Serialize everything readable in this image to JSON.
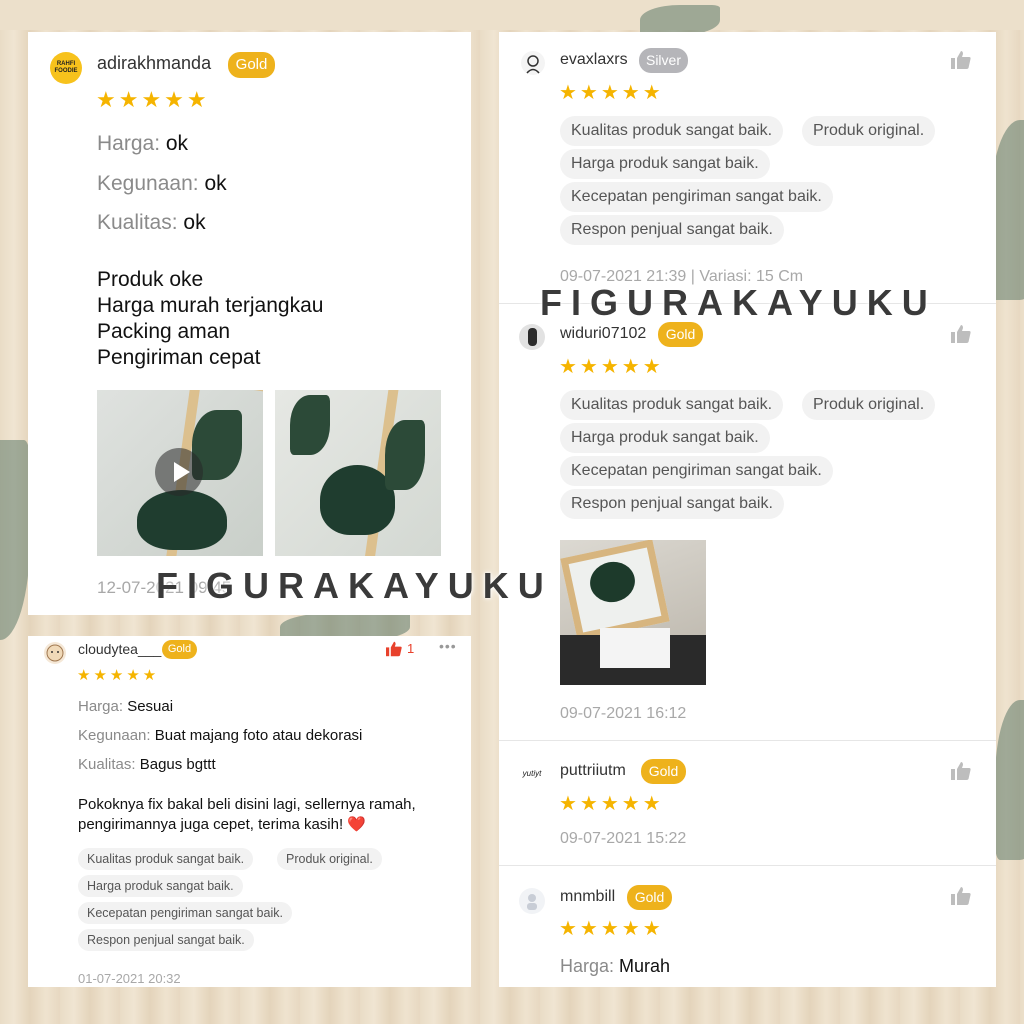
{
  "watermark": "FIGURAKAYUKU",
  "review1": {
    "username": "adirakhmanda",
    "badge": "Gold",
    "avatar_text": "RAHFI FOODIE",
    "stars": "★★★★★",
    "harga_label": "Harga:",
    "harga_value": "ok",
    "kegunaan_label": "Kegunaan:",
    "kegunaan_value": "ok",
    "kualitas_label": "Kualitas:",
    "kualitas_value": "ok",
    "body_lines": [
      "Produk oke",
      "Harga murah terjangkau",
      "Packing aman",
      "Pengiriman cepat"
    ],
    "timestamp": "12-07-2021 09:45",
    "media": [
      "video-thumbnail",
      "photo"
    ]
  },
  "review2": {
    "username": "evaxlaxrs",
    "badge": "Silver",
    "stars": "★★★★★",
    "tags": [
      "Kualitas produk sangat baik.",
      "Produk original.",
      "Harga produk sangat baik.",
      "Kecepatan pengiriman sangat baik.",
      "Respon penjual sangat baik."
    ],
    "timestamp": "09-07-2021 21:39 | Variasi: 15 Cm"
  },
  "review3": {
    "username": "widuri07102",
    "badge": "Gold",
    "stars": "★★★★★",
    "tags": [
      "Kualitas produk sangat baik.",
      "Produk original.",
      "Harga produk sangat baik.",
      "Kecepatan pengiriman sangat baik.",
      "Respon penjual sangat baik."
    ],
    "timestamp": "09-07-2021 16:12"
  },
  "review4": {
    "username": "puttriiutm",
    "badge": "Gold",
    "avatar_text": "yutiyt",
    "stars": "★★★★★",
    "timestamp": "09-07-2021 15:22"
  },
  "review5": {
    "username": "mnmbill",
    "badge": "Gold",
    "stars": "★★★★★",
    "harga_label": "Harga:",
    "harga_value": "Murah"
  },
  "review6": {
    "username": "cloudytea___",
    "badge": "Gold",
    "like_count": "1",
    "more": "•••",
    "stars": "★★★★★",
    "harga_label": "Harga:",
    "harga_value": "Sesuai",
    "kegunaan_label": "Kegunaan:",
    "kegunaan_value": "Buat majang foto atau dekorasi",
    "kualitas_label": "Kualitas:",
    "kualitas_value": "Bagus bgttt",
    "body_line1": "Pokoknya fix bakal beli disini lagi, sellernya ramah,",
    "body_line2": "pengirimannya juga cepet, terima kasih!",
    "heart": "❤️",
    "tags": [
      "Kualitas produk sangat baik.",
      "Produk original.",
      "Harga produk sangat baik.",
      "Kecepatan pengiriman sangat baik.",
      "Respon penjual sangat baik."
    ],
    "timestamp": "01-07-2021 20:32"
  },
  "colors": {
    "gold": "#eeb21c",
    "silver": "#b5b5b9",
    "star": "#f5b400",
    "like_active": "#e8412c"
  }
}
